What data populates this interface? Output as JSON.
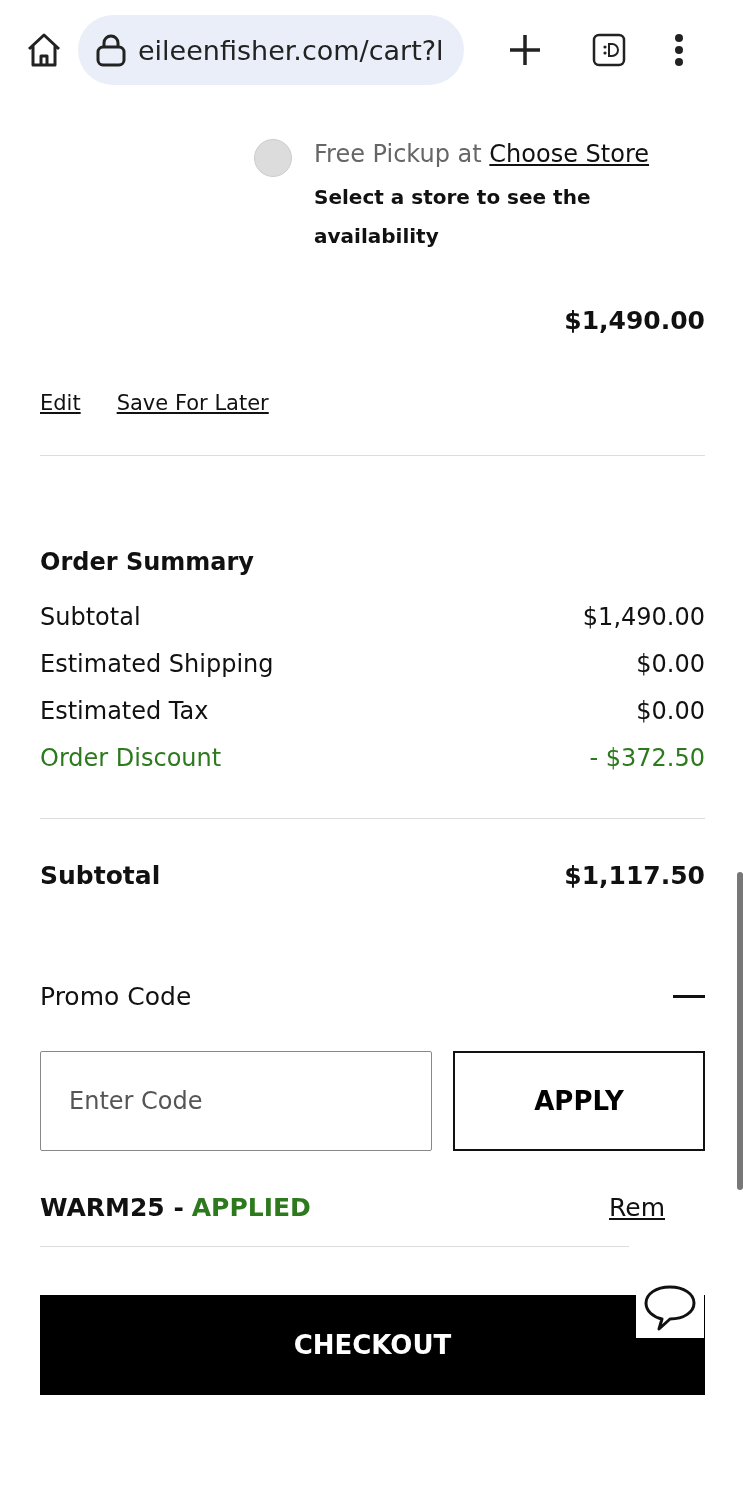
{
  "browser": {
    "url": "eileenfisher.com/cart?l"
  },
  "pickup": {
    "selected": false,
    "label": "Free Pickup at",
    "link": "Choose Store",
    "note": "Select a store to see the availability"
  },
  "item_price": "$1,490.00",
  "item_actions": [
    "Edit",
    "Save For Later"
  ],
  "summary": {
    "title": "Order Summary",
    "rows": [
      {
        "label": "Subtotal",
        "value": "$1,490.00",
        "kind": "normal"
      },
      {
        "label": "Estimated Shipping",
        "value": "$0.00",
        "kind": "normal"
      },
      {
        "label": "Estimated Tax",
        "value": "$0.00",
        "kind": "normal"
      },
      {
        "label": "Order Discount",
        "value": "- $372.50",
        "kind": "discount"
      }
    ],
    "total_label": "Subtotal",
    "total_value": "$1,117.50"
  },
  "promo": {
    "title": "Promo Code",
    "expanded": true,
    "placeholder": "Enter Code",
    "button": "APPLY",
    "code": "WARM25 -",
    "status": "APPLIED",
    "remove": "Rem"
  },
  "checkout": "CHECKOUT"
}
